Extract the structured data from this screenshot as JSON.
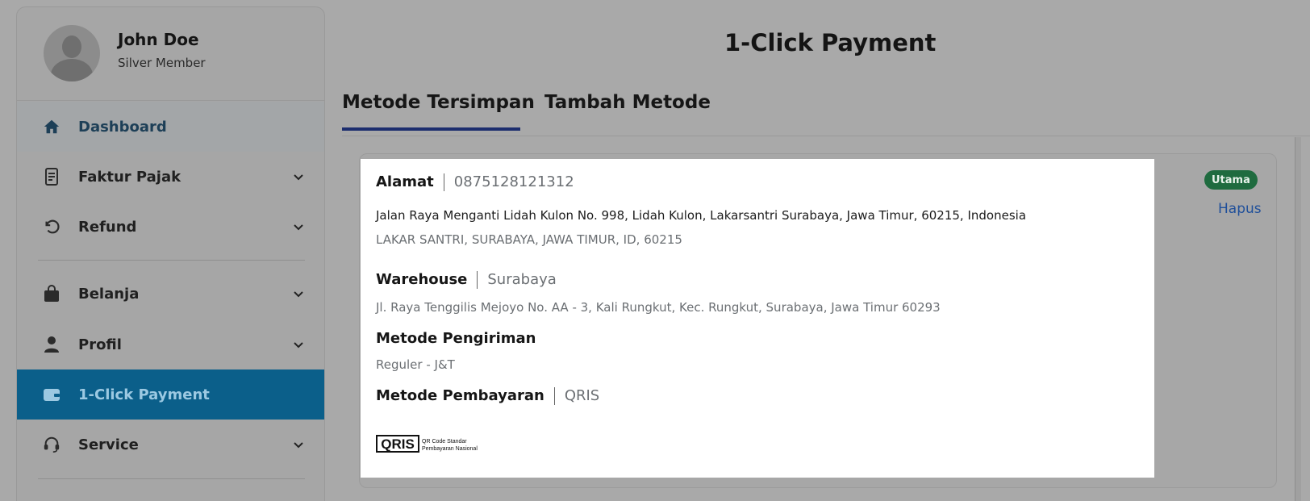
{
  "profile": {
    "name": "John Doe",
    "tier": "Silver Member"
  },
  "sidebar": {
    "items": [
      {
        "label": "Dashboard",
        "icon": "home-icon",
        "chevron": false
      },
      {
        "label": "Faktur Pajak",
        "icon": "document-icon",
        "chevron": true
      },
      {
        "label": "Refund",
        "icon": "refund-icon",
        "chevron": true
      },
      {
        "label": "Belanja",
        "icon": "shopping-bag-icon",
        "chevron": true
      },
      {
        "label": "Profil",
        "icon": "user-icon",
        "chevron": true
      },
      {
        "label": "1-Click Payment",
        "icon": "wallet-icon",
        "chevron": false,
        "active": true
      },
      {
        "label": "Service",
        "icon": "headset-icon",
        "chevron": true
      }
    ]
  },
  "page": {
    "title": "1-Click Payment"
  },
  "tabs": [
    {
      "label": "Metode Tersimpan",
      "active": true
    },
    {
      "label": "Tambah Metode",
      "active": false
    }
  ],
  "card": {
    "address": {
      "label": "Alamat",
      "phone": "0875128121312",
      "line1": "Jalan Raya Menganti Lidah Kulon No. 998, Lidah Kulon, Lakarsantri Surabaya, Jawa Timur, 60215, Indonesia",
      "line2": "LAKAR SANTRI, SURABAYA, JAWA TIMUR, ID, 60215"
    },
    "warehouse": {
      "label": "Warehouse",
      "city": "Surabaya",
      "address": "Jl. Raya Tenggilis Mejoyo No. AA - 3, Kali Rungkut, Kec. Rungkut, Surabaya, Jawa Timur 60293"
    },
    "shipping": {
      "label": "Metode Pengiriman",
      "value": "Reguler - J&T"
    },
    "payment": {
      "label": "Metode Pembayaran",
      "value": "QRIS"
    },
    "qris": {
      "brand": "QRIS",
      "tagline1": "QR Code Standar",
      "tagline2": "Pembayaran Nasional"
    }
  },
  "badge": {
    "label": "Utama",
    "color": "#1f6b3f"
  },
  "actions": {
    "delete_label": "Hapus"
  },
  "colors": {
    "active_menu": "#0b5f8a",
    "tab_underline": "#1c2d6e",
    "link": "#1f4f9a"
  }
}
